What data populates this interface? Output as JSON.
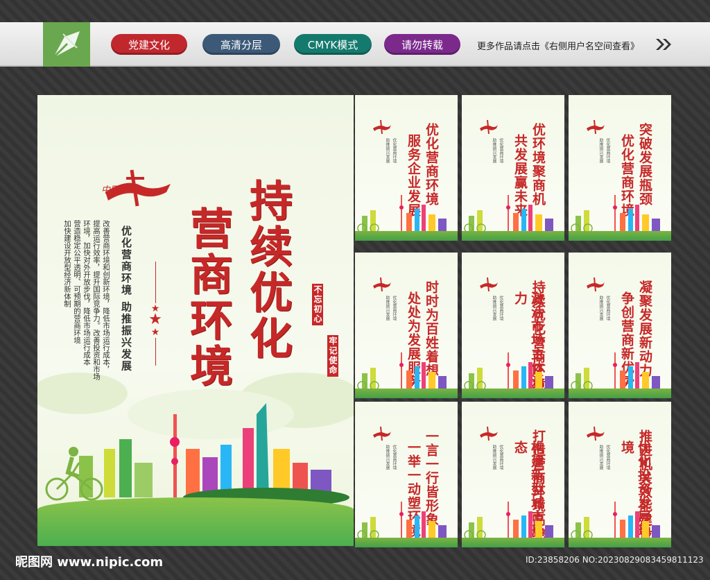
{
  "header": {
    "tags": [
      {
        "label": "党建文化",
        "color": "#c0282e"
      },
      {
        "label": "高清分层",
        "color": "#3c5a78"
      },
      {
        "label": "CMYK模式",
        "color": "#157a6e"
      },
      {
        "label": "请勿转载",
        "color": "#7b2a8c"
      }
    ],
    "note": "更多作品请点击《右侧用户名空间查看》"
  },
  "main_poster": {
    "title_lines": [
      "持续优化",
      "营商环境"
    ],
    "subtitle": "优化营商环境 助推振兴发展",
    "body_lines": [
      "改善营商环境和创新环境，降低市场运行成本，",
      "提高运行效率，提升国际竞争力。改善投资和市场",
      "环境，加快对外开放步伐，降低市场运行成本",
      "营造稳定公平透明、可预期的营商环境",
      "加快建设开放型经济新体制"
    ],
    "logo_text": "中国梦",
    "badge_left": "不忘初心",
    "badge_right": "牢记使命"
  },
  "posters": [
    {
      "lines": [
        "优化营商环境",
        "服务企业发展"
      ]
    },
    {
      "lines": [
        "优环境聚商机",
        "共发展赢未来"
      ]
    },
    {
      "lines": [
        "突破发展瓶颈",
        "优化营商环境"
      ]
    },
    {
      "lines": [
        "时时为百姓着想",
        "处处为发展服务"
      ]
    },
    {
      "lines": [
        "持续优化营商环境",
        "激活市场主体活力"
      ]
    },
    {
      "lines": [
        "凝聚发展新动力",
        "争创营商新优势"
      ]
    },
    {
      "lines": [
        "一言一行皆形象",
        "一举一动塑环境"
      ]
    },
    {
      "lines": [
        "打造营商环境高地",
        "构建新型城市形态"
      ]
    },
    {
      "lines": [
        "推进机关效能建设",
        "优化投资发展环境"
      ]
    }
  ],
  "poster_small_text": [
    "优化营商环境",
    "助推振兴发展"
  ],
  "footer": {
    "site": "昵图网 www.nipic.com",
    "id": "ID:23858206 NO:20230829083459811123"
  }
}
